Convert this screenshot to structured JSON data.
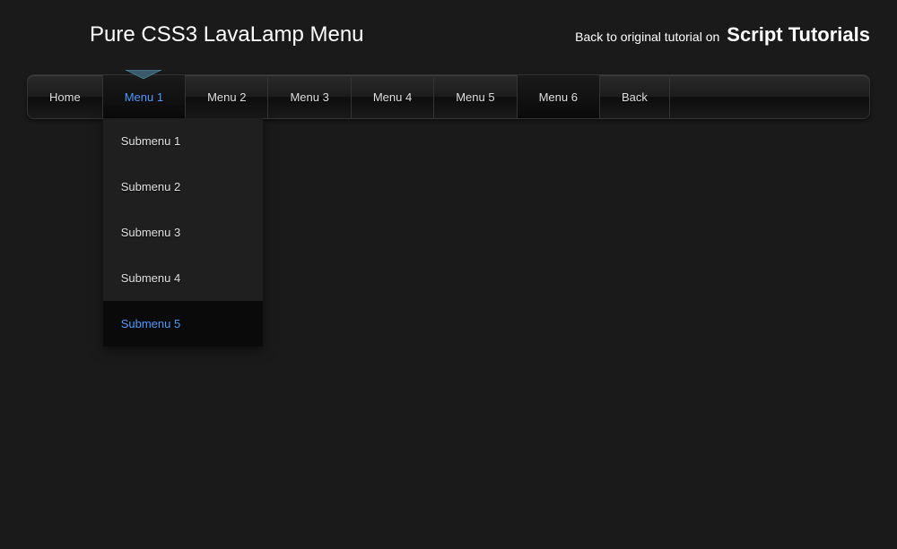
{
  "header": {
    "title": "Pure CSS3 LavaLamp Menu",
    "back_prefix": "Back to original tutorial on",
    "back_brand": "Script Tutorials"
  },
  "nav": {
    "items": [
      {
        "label": "Home",
        "active": false
      },
      {
        "label": "Menu 1",
        "active": true
      },
      {
        "label": "Menu 2",
        "active": false
      },
      {
        "label": "Menu 3",
        "active": false
      },
      {
        "label": "Menu 4",
        "active": false
      },
      {
        "label": "Menu 5",
        "active": false
      },
      {
        "label": "Menu 6",
        "active": false
      },
      {
        "label": "Back",
        "active": false
      }
    ]
  },
  "submenu": {
    "items": [
      {
        "label": "Submenu 1",
        "hovered": false
      },
      {
        "label": "Submenu 2",
        "hovered": false
      },
      {
        "label": "Submenu 3",
        "hovered": false
      },
      {
        "label": "Submenu 4",
        "hovered": false
      },
      {
        "label": "Submenu 5",
        "hovered": true
      }
    ]
  }
}
